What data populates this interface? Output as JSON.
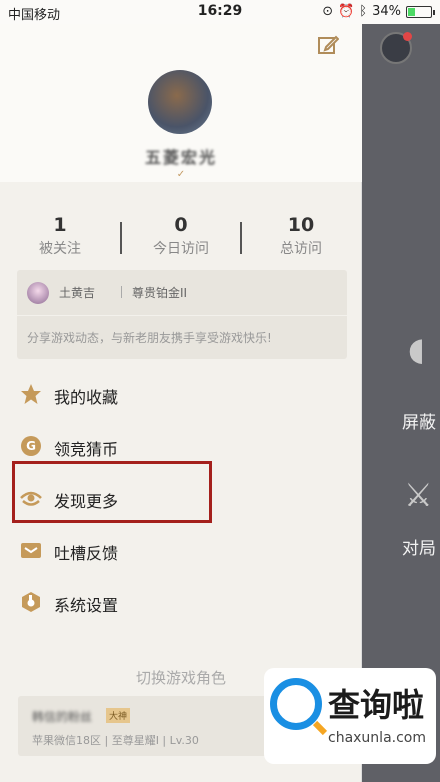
{
  "status_bar": {
    "carrier": "中国移动",
    "time": "16:29",
    "battery": "34%",
    "battery_level": 0.34
  },
  "background": {
    "item1_label": "屏蔽",
    "item2_label": "对局"
  },
  "profile": {
    "nickname": "五菱宏光",
    "sub_note": "✓"
  },
  "stats": [
    {
      "value": "1",
      "label": "被关注"
    },
    {
      "value": "0",
      "label": "今日访问"
    },
    {
      "value": "10",
      "label": "总访问"
    }
  ],
  "share_card": {
    "hero": "土黄吉",
    "rank": "尊贵铂金II",
    "message": "分享游戏动态，与新老朋友携手享受游戏快乐!"
  },
  "menu": [
    {
      "label": "我的收藏",
      "icon": "star-icon"
    },
    {
      "label": "领竞猜币",
      "icon": "coin-icon"
    },
    {
      "label": "发现更多",
      "icon": "eye-icon"
    },
    {
      "label": "吐槽反馈",
      "icon": "feedback-icon"
    },
    {
      "label": "系统设置",
      "icon": "settings-icon"
    }
  ],
  "switch_role": {
    "title": "切换游戏角色",
    "role_name": "韩信的粉丝",
    "role_tag": "大神",
    "role_info": "苹果微信18区 | 至尊星耀I | Lv.30"
  },
  "watermark": {
    "title": "查询啦",
    "url": "chaxunla.com"
  },
  "colors": {
    "accent_gold": "#b08c5a",
    "highlight_red": "#a4201c",
    "watermark_blue": "#1a8fe3"
  }
}
